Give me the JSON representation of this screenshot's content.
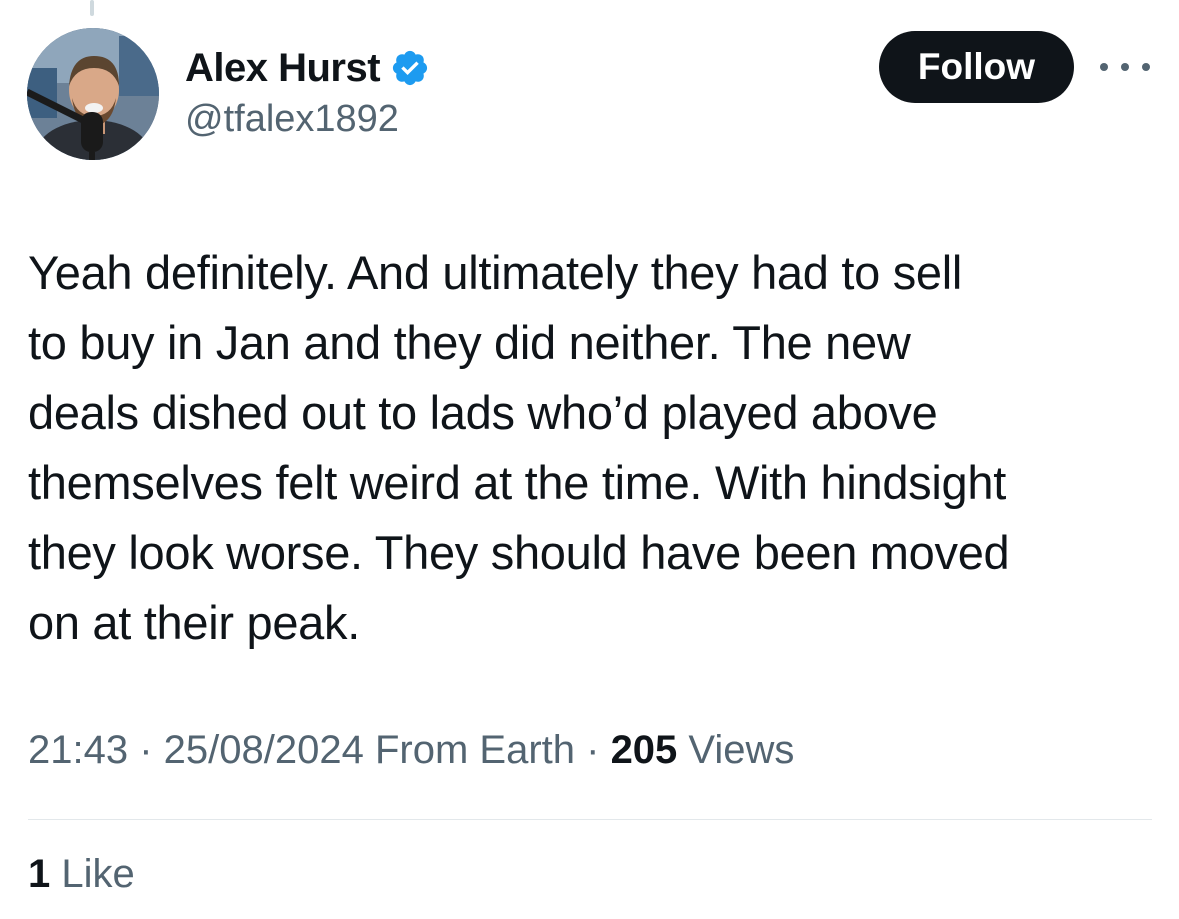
{
  "author": {
    "display_name": "Alex Hurst",
    "handle": "@tfalex1892",
    "verified": true
  },
  "actions": {
    "follow_label": "Follow",
    "more_icon": "more-horizontal-icon"
  },
  "tweet": {
    "lines": [
      "Yeah definitely. And ultimately they had to sell",
      "to buy in Jan and they did neither. The new",
      "deals dished out to lads who’d played above",
      "themselves felt weird at the time. With hindsight",
      "they look worse. They should have been moved",
      "on at their peak."
    ]
  },
  "meta": {
    "time": "21:43",
    "separator": " · ",
    "date": "25/08/2024",
    "source": " From Earth",
    "views_count": "205",
    "views_label": " Views"
  },
  "engagement": {
    "likes_count": "1",
    "likes_label": " Like"
  },
  "colors": {
    "text_primary": "#0f1419",
    "text_secondary": "#536471",
    "verified_blue": "#1d9bf0",
    "divider": "#e3e8eb"
  }
}
